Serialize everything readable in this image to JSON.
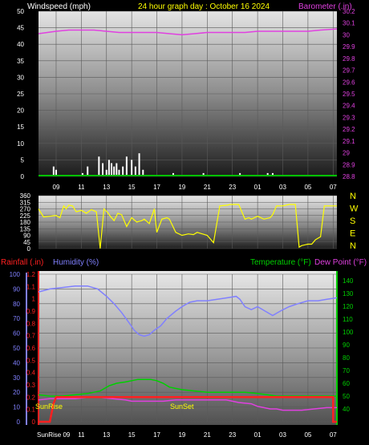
{
  "colors": {
    "background": "#000000",
    "wind_label": "#ffffff",
    "title": "#ffff00",
    "barometer": "#e040e0",
    "direction": "#ffff00",
    "rain": "#ff2020",
    "humidity": "#8080ff",
    "temperature": "#00d000",
    "dewpoint": "#e040e0",
    "tick": "#ffffff"
  },
  "chart_data": [
    {
      "type": "line",
      "id": "wind_baro",
      "title": "24 hour graph day : October 16 2024",
      "left_label": "Windspeed (mph)",
      "right_label": "Barometer (.in)",
      "x_ticks": [
        "09",
        "11",
        "13",
        "15",
        "17",
        "19",
        "21",
        "23",
        "01",
        "03",
        "05",
        "07"
      ],
      "y_left_ticks": [
        "50",
        "45",
        "40",
        "35",
        "30",
        "25",
        "20",
        "15",
        "10",
        "5",
        "0"
      ],
      "y_left_range": [
        0,
        50
      ],
      "y_right_ticks": [
        "30.2",
        "30.1",
        "30",
        "29.9",
        "29.8",
        "29.7",
        "29.6",
        "29.5",
        "29.4",
        "29.3",
        "29.2",
        "29.1",
        "29",
        "28.9",
        "28.8"
      ],
      "y_right_range": [
        28.8,
        30.2
      ],
      "grid": true,
      "series": [
        {
          "name": "Barometer",
          "axis": "right",
          "x": [
            7.6,
            9,
            10,
            11,
            12,
            13,
            14,
            15,
            16,
            17,
            18,
            19,
            20,
            21,
            22,
            23,
            24,
            25,
            26,
            27,
            28,
            29,
            30,
            31.3
          ],
          "values": [
            30.01,
            30.03,
            30.04,
            30.04,
            30.04,
            30.03,
            30.02,
            30.02,
            30.02,
            30.02,
            30.01,
            30.0,
            30.01,
            30.02,
            30.02,
            30.02,
            30.02,
            30.03,
            30.03,
            30.03,
            30.03,
            30.03,
            30.04,
            30.05
          ]
        },
        {
          "name": "Windspeed",
          "axis": "left",
          "x": [
            8.8,
            9.0,
            11.1,
            11.5,
            12.4,
            12.7,
            13.0,
            13.2,
            13.4,
            13.6,
            13.8,
            14.0,
            14.3,
            14.6,
            15.0,
            15.3,
            15.6,
            15.9,
            18.3,
            20.7,
            23.6,
            25.8,
            26.2
          ],
          "values": [
            3,
            2,
            1,
            3,
            6,
            4,
            2,
            5,
            4,
            3,
            4,
            2,
            3,
            6,
            5,
            3,
            7,
            2,
            1,
            1,
            1,
            1,
            1
          ]
        }
      ]
    },
    {
      "type": "line",
      "id": "wind_direction",
      "y_left_ticks": [
        "360",
        "315",
        "270",
        "225",
        "180",
        "135",
        "90",
        "45",
        "0"
      ],
      "y_range": [
        0,
        360
      ],
      "compass": [
        "N",
        "W",
        "S",
        "E",
        "N"
      ],
      "grid": true,
      "series": [
        {
          "name": "Wind Direction",
          "x": [
            7.6,
            8.0,
            8.5,
            9.0,
            9.3,
            9.6,
            9.8,
            10.0,
            10.3,
            10.6,
            11.0,
            11.4,
            11.8,
            12.2,
            12.5,
            12.8,
            13.1,
            13.3,
            13.6,
            13.9,
            14.2,
            14.6,
            15.0,
            15.4,
            15.8,
            16.0,
            16.4,
            16.8,
            17.0,
            17.4,
            17.8,
            18.0,
            18.5,
            19.0,
            19.5,
            19.9,
            20.2,
            20.6,
            21.0,
            21.5,
            22.0,
            22.6,
            22.8,
            23.0,
            23.5,
            24.0,
            24.3,
            24.5,
            25.0,
            25.5,
            26.0,
            26.2,
            26.5,
            27.0,
            27.5,
            28.0,
            28.3,
            28.5,
            29.0,
            29.3,
            29.6,
            30.0,
            30.3,
            31.3
          ],
          "values": [
            270,
            215,
            220,
            225,
            210,
            290,
            270,
            295,
            290,
            250,
            260,
            240,
            265,
            250,
            0,
            270,
            245,
            220,
            190,
            240,
            230,
            150,
            210,
            180,
            190,
            200,
            170,
            270,
            110,
            200,
            210,
            200,
            110,
            90,
            100,
            95,
            110,
            100,
            90,
            40,
            290,
            295,
            300,
            300,
            300,
            200,
            210,
            200,
            220,
            200,
            210,
            230,
            290,
            290,
            300,
            300,
            10,
            20,
            30,
            30,
            60,
            80,
            290,
            290
          ]
        }
      ]
    },
    {
      "type": "line",
      "id": "temp_hum_rain",
      "labels": {
        "rain": "Rainfall (.in)",
        "humidity": "Humidity (%)",
        "temperature": "Temperature (°F)",
        "dewpoint": "Dew Point (°F)"
      },
      "x_ticks": [
        "SunRise 09",
        "11",
        "13",
        "15",
        "17",
        "19",
        "21",
        "23",
        "01",
        "03",
        "05",
        "07"
      ],
      "y_humidity_ticks": [
        "100",
        "90",
        "80",
        "70",
        "60",
        "50",
        "40",
        "30",
        "20",
        "10",
        "0"
      ],
      "y_humidity_range": [
        0,
        100
      ],
      "y_rain_ticks": [
        "1.2",
        "1.1",
        "1",
        "0.9",
        "0.8",
        "0.7",
        "0.6",
        "0.5",
        "0.4",
        "0.3",
        "0.2",
        "0.1",
        "0"
      ],
      "y_rain_range": [
        0,
        1.2
      ],
      "y_temp_ticks": [
        "140",
        "130",
        "120",
        "110",
        "100",
        "90",
        "80",
        "70",
        "60",
        "50",
        "40"
      ],
      "y_temp_range": [
        30,
        145
      ],
      "annotations": {
        "sunrise": "SunRise",
        "sunset": "SunSet"
      },
      "grid": true,
      "series": [
        {
          "name": "Humidity",
          "x": [
            7.6,
            8.5,
            9.5,
            10.5,
            11.5,
            12.3,
            13.0,
            13.6,
            14.2,
            14.8,
            15.2,
            15.6,
            16.0,
            16.4,
            16.8,
            17.3,
            17.8,
            18.5,
            19.0,
            19.6,
            20.2,
            21.0,
            21.8,
            22.6,
            23.3,
            23.6,
            24.0,
            24.5,
            25.0,
            25.6,
            26.2,
            26.8,
            27.5,
            28.2,
            29.0,
            29.8,
            30.5,
            31.3
          ],
          "values": [
            88,
            90,
            91,
            92,
            92,
            90,
            85,
            80,
            74,
            67,
            62,
            59,
            58,
            59,
            62,
            65,
            70,
            75,
            78,
            81,
            82,
            82,
            83,
            84,
            85,
            83,
            78,
            76,
            78,
            75,
            72,
            75,
            78,
            80,
            82,
            82,
            83,
            84
          ]
        },
        {
          "name": "Temperature",
          "x": [
            7.6,
            8.5,
            9.5,
            10.5,
            11.5,
            12.5,
            13.2,
            13.8,
            14.5,
            15.0,
            15.5,
            16.0,
            16.5,
            17.0,
            17.5,
            18.0,
            19.0,
            20.0,
            21.0,
            22.0,
            23.0,
            24.0,
            25.0,
            25.8,
            26.5,
            27.5,
            28.5,
            29.5,
            30.5,
            31.3
          ],
          "values": [
            51,
            50,
            50,
            51,
            52,
            54,
            58,
            60,
            61,
            62,
            63,
            63,
            63,
            62,
            60,
            57,
            55,
            54,
            53,
            53,
            53,
            53,
            52,
            51,
            50,
            50,
            50,
            50,
            50,
            50
          ]
        },
        {
          "name": "Dew Point",
          "x": [
            7.6,
            8.5,
            9.5,
            10.5,
            11.5,
            12.5,
            13.5,
            14.5,
            15.0,
            15.5,
            16.0,
            16.5,
            17.0,
            17.5,
            18.5,
            19.5,
            20.5,
            21.5,
            22.5,
            23.5,
            24.5,
            25.0,
            25.5,
            26.0,
            26.5,
            27.0,
            27.5,
            28.5,
            29.5,
            30.5,
            31.3
          ],
          "values": [
            47,
            48,
            48,
            48,
            49,
            49,
            48,
            47,
            46,
            46,
            46,
            46,
            46,
            46,
            47,
            47,
            47,
            47,
            47,
            45,
            44,
            42,
            41,
            40,
            40,
            39,
            39,
            39,
            40,
            41,
            41
          ]
        },
        {
          "name": "Rainfall",
          "x": [
            7.6,
            8.5,
            8.8,
            9.0,
            31.0,
            31.0,
            31.3
          ],
          "values": [
            0,
            0,
            0.15,
            0.2,
            0.2,
            0,
            0
          ]
        }
      ]
    }
  ]
}
